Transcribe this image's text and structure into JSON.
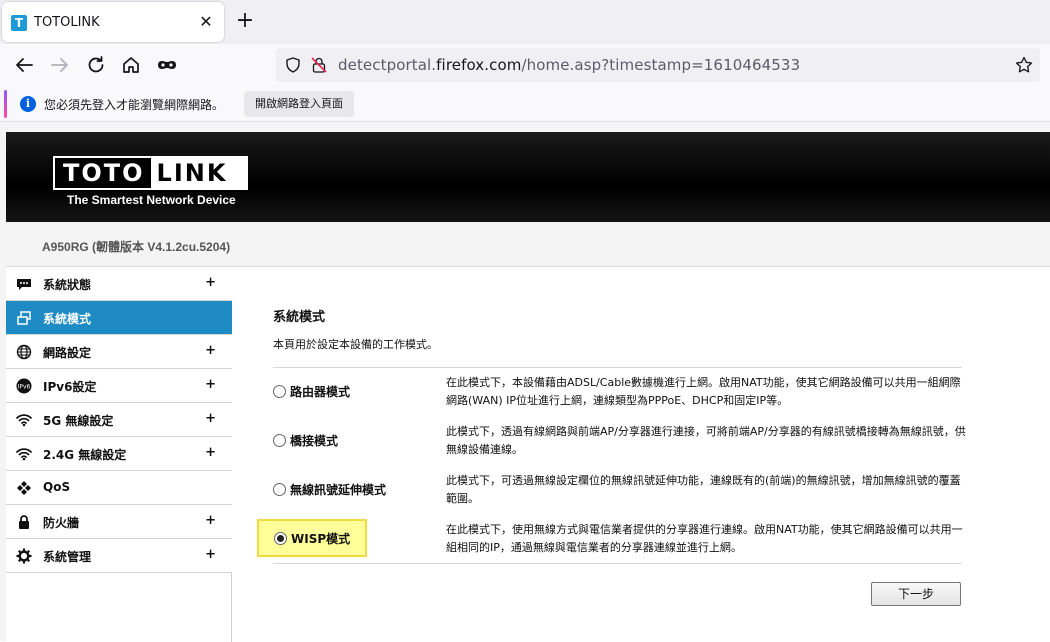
{
  "browser": {
    "tab_title": "TOTOLINK",
    "tab_favicon": "T",
    "close_glyph": "✕",
    "new_tab_glyph": "+",
    "url_prefix": "detectportal.",
    "url_domain": "firefox.com",
    "url_suffix": "/home.asp?timestamp=1610464533",
    "notification_text": "您必須先登入才能瀏覽網際網路。",
    "notification_button": "開啟網路登入頁面",
    "notification_icon": "i"
  },
  "header": {
    "logo_left": "TOTO",
    "logo_right": "LINK",
    "tagline": "The Smartest Network Device",
    "version": "A950RG (韌體版本 V4.1.2cu.5204)"
  },
  "sidebar": {
    "items": [
      {
        "label": "系統狀態",
        "icon": "chat-icon",
        "plus": "+"
      },
      {
        "label": "系統模式",
        "icon": "window-icon",
        "plus": ""
      },
      {
        "label": "網路設定",
        "icon": "globe-icon",
        "plus": "+"
      },
      {
        "label": "IPv6設定",
        "icon": "ipv6-icon",
        "plus": "+"
      },
      {
        "label": "5G 無線設定",
        "icon": "wifi-icon",
        "plus": "+"
      },
      {
        "label": "2.4G 無線設定",
        "icon": "wifi-icon",
        "plus": "+"
      },
      {
        "label": "QoS",
        "icon": "qos-icon",
        "plus": ""
      },
      {
        "label": "防火牆",
        "icon": "lock-icon",
        "plus": "+"
      },
      {
        "label": "系統管理",
        "icon": "gear-icon",
        "plus": "+"
      }
    ]
  },
  "main": {
    "title": "系統模式",
    "description": "本頁用於設定本設備的工作模式。",
    "modes": [
      {
        "label": "路由器模式",
        "desc": "在此模式下，本設備藉由ADSL/Cable數據機進行上網。啟用NAT功能，使其它網路設備可以共用一組網際網路(WAN) IP位址進行上網，連線類型為PPPoE、DHCP和固定IP等。",
        "checked": false
      },
      {
        "label": "橋接模式",
        "desc": "此模式下，透過有線網路與前端AP/分享器進行連接，可將前端AP/分享器的有線訊號橋接轉為無線訊號，供無線設備連線。",
        "checked": false
      },
      {
        "label": "無線訊號延伸模式",
        "desc": "此模式下，可透過無線設定欄位的無線訊號延伸功能，連線既有的(前端)的無線訊號，增加無線訊號的覆蓋範圍。",
        "checked": false
      },
      {
        "label": "WISP模式",
        "desc": "在此模式下，使用無線方式與電信業者提供的分享器進行連線。啟用NAT功能，使其它網路設備可以共用一組相同的IP，通過無線與電信業者的分享器連線並進行上網。",
        "checked": true
      }
    ],
    "next_button": "下一步"
  },
  "colors": {
    "sidebar_active": "#1f8bc4",
    "highlight_fill": "#ffff99",
    "highlight_border": "#f0dc40"
  }
}
